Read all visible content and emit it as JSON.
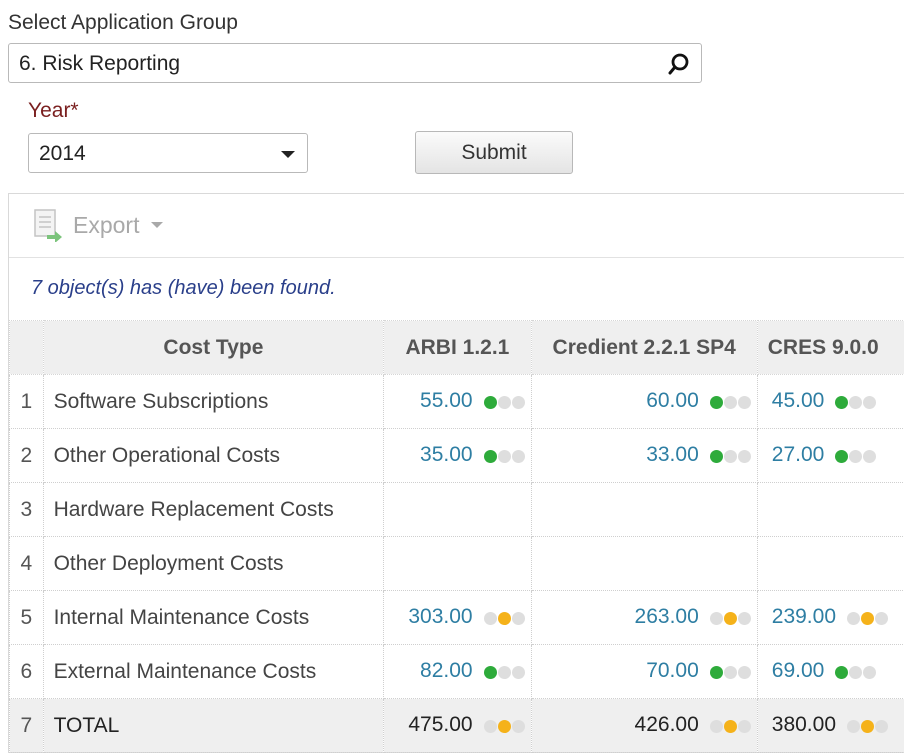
{
  "app_group": {
    "label": "Select Application Group",
    "value": "6. Risk Reporting"
  },
  "year": {
    "label": "Year*",
    "value": "2014"
  },
  "submit_label": "Submit",
  "toolbar": {
    "export_label": "Export"
  },
  "found_message": "7 object(s) has (have) been found.",
  "table": {
    "columns": [
      "Cost Type",
      "ARBI 1.2.1",
      "Credient 2.2.1 SP4",
      "CRES 9.0.0"
    ],
    "rows": [
      {
        "idx": "1",
        "cost_type": "Software Subscriptions",
        "cells": [
          {
            "value": "55.00",
            "status": "green"
          },
          {
            "value": "60.00",
            "status": "green"
          },
          {
            "value": "45.00",
            "status": "green"
          }
        ]
      },
      {
        "idx": "2",
        "cost_type": "Other Operational Costs",
        "cells": [
          {
            "value": "35.00",
            "status": "green"
          },
          {
            "value": "33.00",
            "status": "green"
          },
          {
            "value": "27.00",
            "status": "green"
          }
        ]
      },
      {
        "idx": "3",
        "cost_type": "Hardware Replacement Costs",
        "cells": [
          {
            "value": "",
            "status": ""
          },
          {
            "value": "",
            "status": ""
          },
          {
            "value": "",
            "status": ""
          }
        ]
      },
      {
        "idx": "4",
        "cost_type": "Other Deployment Costs",
        "cells": [
          {
            "value": "",
            "status": ""
          },
          {
            "value": "",
            "status": ""
          },
          {
            "value": "",
            "status": ""
          }
        ]
      },
      {
        "idx": "5",
        "cost_type": "Internal Maintenance Costs",
        "cells": [
          {
            "value": "303.00",
            "status": "yellow"
          },
          {
            "value": "263.00",
            "status": "yellow"
          },
          {
            "value": "239.00",
            "status": "yellow"
          }
        ]
      },
      {
        "idx": "6",
        "cost_type": "External Maintenance Costs",
        "cells": [
          {
            "value": "82.00",
            "status": "green"
          },
          {
            "value": "70.00",
            "status": "green"
          },
          {
            "value": "69.00",
            "status": "green"
          }
        ]
      },
      {
        "idx": "7",
        "cost_type": "TOTAL",
        "total": true,
        "cells": [
          {
            "value": "475.00",
            "status": "yellow"
          },
          {
            "value": "426.00",
            "status": "yellow"
          },
          {
            "value": "380.00",
            "status": "yellow"
          }
        ]
      }
    ]
  },
  "colors": {
    "value_link": "#2e7ea3",
    "status_green": "#2eab3b",
    "status_yellow": "#f5b21a",
    "required_label": "#7a1f1f",
    "found_text": "#2a3f8a"
  }
}
